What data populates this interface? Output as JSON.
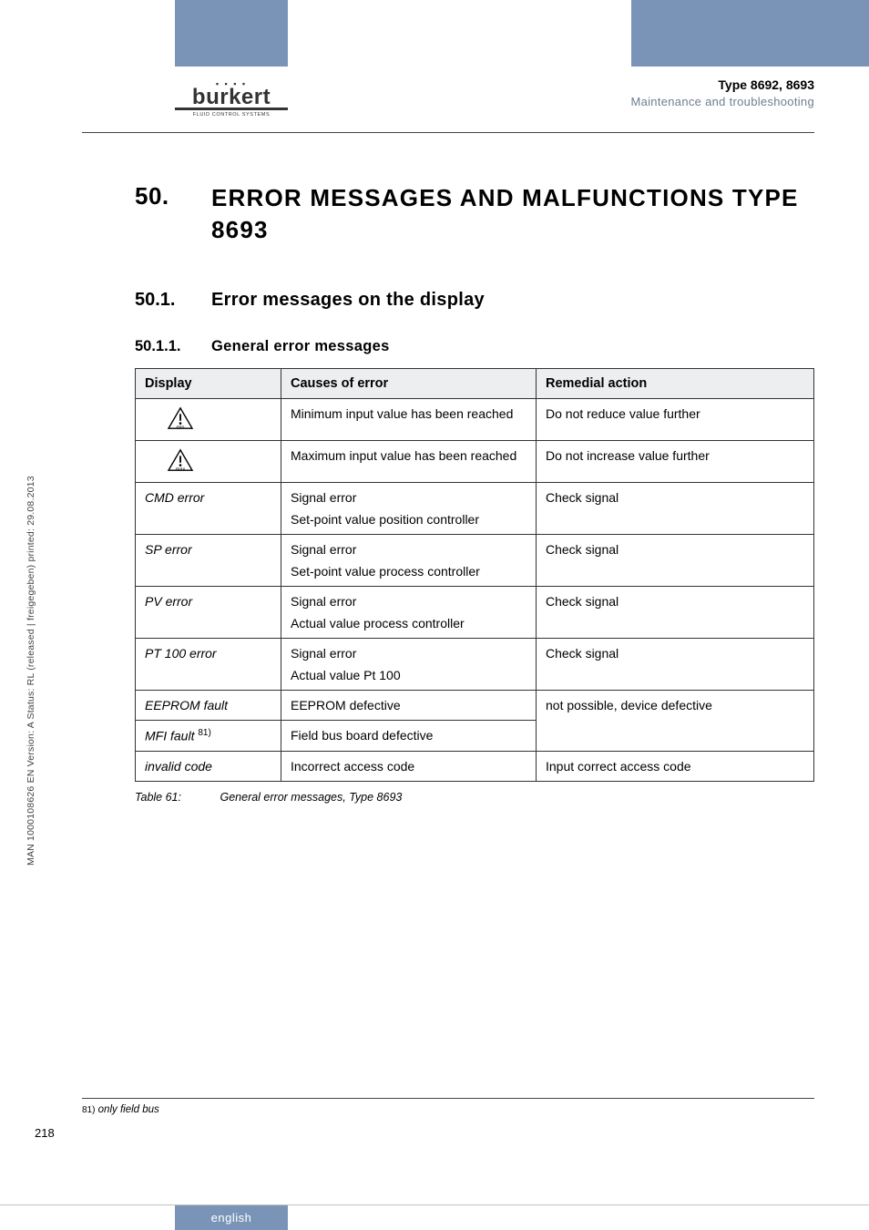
{
  "header": {
    "type_line": "Type 8692, 8693",
    "subtitle": "Maintenance and troubleshooting"
  },
  "logo": {
    "name": "burkert",
    "tagline": "FLUID CONTROL SYSTEMS"
  },
  "section": {
    "num": "50.",
    "title": "ERROR MESSAGES AND MALFUNCTIONS TYPE 8693"
  },
  "subsection": {
    "num": "50.1.",
    "title": "Error messages on the display"
  },
  "subsubsection": {
    "num": "50.1.1.",
    "title": "General error messages"
  },
  "table": {
    "headers": {
      "display": "Display",
      "causes": "Causes of error",
      "remedial": "Remedial action"
    },
    "rows": [
      {
        "display_type": "icon",
        "icon_label": "min",
        "causes": "Minimum input value has been reached",
        "remedial": "Do not reduce value further"
      },
      {
        "display_type": "icon",
        "icon_label": "max",
        "causes": "Maximum input value has been reached",
        "remedial": "Do not increase value further"
      },
      {
        "display_type": "text",
        "display": "CMD error",
        "causes": "Signal error",
        "causes_line2": "Set-point value  position controller",
        "remedial": "Check signal"
      },
      {
        "display_type": "text",
        "display": "SP error",
        "causes": "Signal error",
        "causes_line2": "Set-point value process controller",
        "remedial": "Check signal"
      },
      {
        "display_type": "text",
        "display": "PV error",
        "causes": "Signal error",
        "causes_line2": "Actual value process controller",
        "remedial": "Check signal"
      },
      {
        "display_type": "text",
        "display": "PT 100 error",
        "causes": "Signal error",
        "causes_line2": "Actual value Pt 100",
        "remedial": "Check signal"
      },
      {
        "display_type": "text",
        "display": "EEPROM fault",
        "causes": "EEPROM defective",
        "remedial": "not possible, device defective",
        "remedial_rowspan": 2
      },
      {
        "display_type": "text_sup",
        "display": "MFI fault ",
        "display_sup": "81)",
        "causes": "Field bus board defective"
      },
      {
        "display_type": "text",
        "display": "invalid code",
        "causes": "Incorrect access code",
        "remedial": "Input correct access code"
      }
    ]
  },
  "caption": {
    "label": "Table 61:",
    "text": "General error messages, Type 8693"
  },
  "footnote": {
    "marker": "81)",
    "text": "only field bus"
  },
  "page_number": "218",
  "bottom_tab": "english",
  "spine_text": "MAN 1000108626 EN Version: A Status: RL (released | freigegeben) printed: 29.08.2013"
}
